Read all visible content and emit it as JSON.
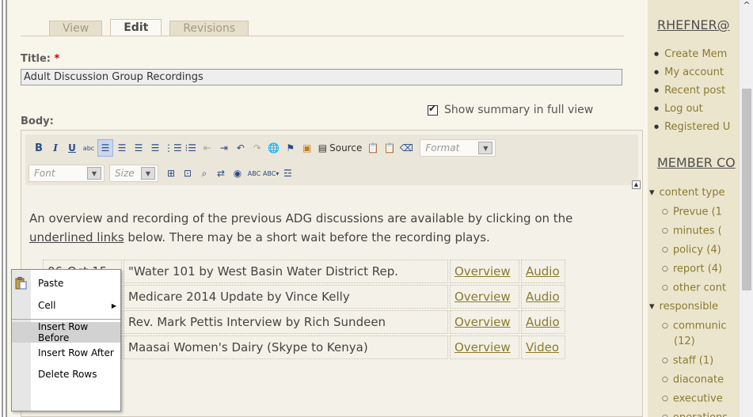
{
  "tabs": [
    {
      "label": "View",
      "active": false
    },
    {
      "label": "Edit",
      "active": true
    },
    {
      "label": "Revisions",
      "active": false
    }
  ],
  "form": {
    "title_label": "Title:",
    "required_mark": "*",
    "title_value": "Adult Discussion Group Recordings",
    "body_label": "Body:",
    "summary_label": "Show summary in full view",
    "summary_checked": true
  },
  "toolbar": {
    "bold": "B",
    "italic": "I",
    "underline": "U",
    "strike": "abc",
    "source_label": "Source",
    "format_placeholder": "Format",
    "font_placeholder": "Font",
    "size_placeholder": "Size"
  },
  "content": {
    "intro_before": "An overview and recording of the previous ADG discussions are available by clicking on the ",
    "intro_link": "underlined links",
    "intro_after": " below.  There may be a short wait before the recording plays."
  },
  "table_rows": [
    {
      "date": "06-Oct-15",
      "topic": "\"Water 101 by West Basin Water District Rep.",
      "overview": "Overview",
      "media": "Audio"
    },
    {
      "date": "",
      "topic": "Medicare 2014 Update by Vince Kelly",
      "overview": "Overview",
      "media": "Audio"
    },
    {
      "date": "",
      "topic": "Rev. Mark Pettis Interview by Rich Sundeen",
      "overview": "Overview",
      "media": "Audio"
    },
    {
      "date": "",
      "topic": "Maasai Women's Dairy (Skype to Kenya)",
      "overview": "Overview",
      "media": "Video"
    }
  ],
  "context_menu": {
    "paste": "Paste",
    "cell": "Cell",
    "insert_before": "Insert Row Before",
    "insert_after": "Insert Row After",
    "delete_rows": "Delete Rows"
  },
  "sidebar": {
    "user_heading": "RHEFNER@",
    "user_links": [
      "Create Mem",
      "My account",
      "Recent post",
      "Log out",
      "Registered U"
    ],
    "member_heading": "MEMBER CO",
    "tree": [
      {
        "label": "content type",
        "level": 0
      },
      {
        "label": "Prevue (1",
        "level": 1
      },
      {
        "label": "minutes (",
        "level": 1
      },
      {
        "label": "policy (4)",
        "level": 1
      },
      {
        "label": "report (4)",
        "level": 1
      },
      {
        "label": "other cont",
        "level": 1
      },
      {
        "label": "responsible",
        "level": 0
      },
      {
        "label": "communic",
        "level": 1
      },
      {
        "label": "(12)",
        "level": 2
      },
      {
        "label": "staff (1)",
        "level": 1
      },
      {
        "label": "diaconate",
        "level": 1
      },
      {
        "label": "executive",
        "level": 1
      },
      {
        "label": "operations",
        "level": 1
      }
    ]
  }
}
